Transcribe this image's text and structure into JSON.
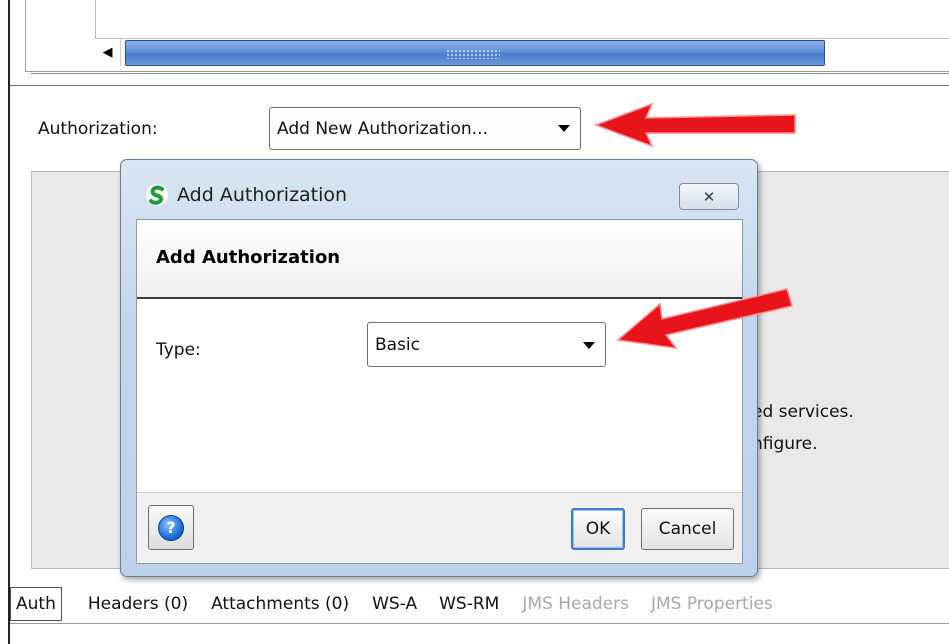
{
  "authorization": {
    "label": "Authorization:",
    "selected": "Add New Authorization..."
  },
  "background_text": {
    "line1": "ed services.",
    "line2": "nfigure."
  },
  "dialog": {
    "title": "Add Authorization",
    "header": "Add Authorization",
    "type_label": "Type:",
    "type_value": "Basic",
    "ok_label": "OK",
    "cancel_label": "Cancel",
    "close_glyph": "✕"
  },
  "tabs": [
    {
      "label": "Auth",
      "state": "active"
    },
    {
      "label": "Headers (0)",
      "state": "enabled"
    },
    {
      "label": "Attachments (0)",
      "state": "enabled"
    },
    {
      "label": "WS-A",
      "state": "enabled"
    },
    {
      "label": "WS-RM",
      "state": "enabled"
    },
    {
      "label": "JMS Headers",
      "state": "disabled"
    },
    {
      "label": "JMS Properties",
      "state": "disabled"
    }
  ],
  "colors": {
    "annotation_arrow": "#e8141c",
    "scroll_thumb": "#5d8fd6",
    "dialog_chrome": "#c3d6ec",
    "app_icon_green": "#1e9a3a"
  },
  "icons": {
    "app": "soapui-logo-icon",
    "help": "help-icon",
    "scroll_left": "arrow-left-icon",
    "dropdown": "chevron-down-icon"
  }
}
